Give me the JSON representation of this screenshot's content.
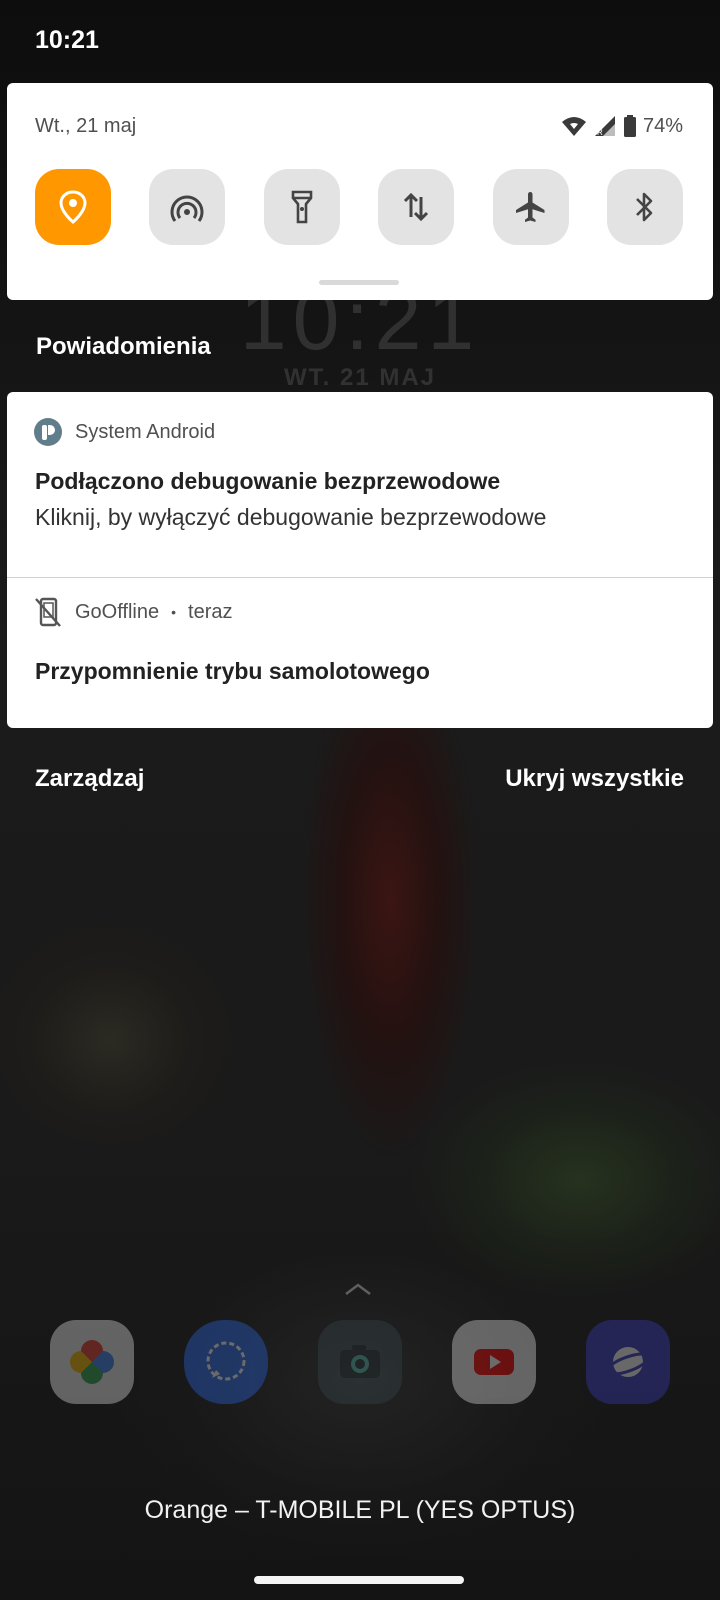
{
  "status_bar": {
    "time": "10:21"
  },
  "quick_settings": {
    "date": "Wt., 21 maj",
    "battery": "74%",
    "tiles": [
      {
        "name": "location",
        "icon": "location-pin-icon",
        "active": true
      },
      {
        "name": "hotspot",
        "icon": "hotspot-icon",
        "active": false
      },
      {
        "name": "flashlight",
        "icon": "flashlight-icon",
        "active": false
      },
      {
        "name": "mobile-data",
        "icon": "data-arrows-icon",
        "active": false
      },
      {
        "name": "airplane-mode",
        "icon": "airplane-icon",
        "active": false
      },
      {
        "name": "bluetooth",
        "icon": "bluetooth-icon",
        "active": false
      }
    ],
    "active_color": "#ff9800",
    "inactive_color": "#e3e3e3"
  },
  "lockscreen": {
    "clock": "10:21",
    "date": "WT. 21 MAJ"
  },
  "notifications": {
    "section_title": "Powiadomienia",
    "items": [
      {
        "app": "System Android",
        "icon": "android-system-icon",
        "title": "Podłączono debugowanie bezprzewodowe",
        "text": "Kliknij, by wyłączyć debugowanie bezprzewodowe"
      },
      {
        "app": "GoOffline",
        "time": "teraz",
        "icon": "phone-offline-icon",
        "title": "Przypomnienie trybu samolotowego"
      }
    ],
    "manage_label": "Zarządzaj",
    "dismiss_all_label": "Ukryj wszystkie"
  },
  "dock": {
    "apps": [
      "google-photos-icon",
      "signal-icon",
      "camera-icon",
      "youtube-icon",
      "samsung-internet-icon"
    ]
  },
  "carrier": "Orange – T-MOBILE PL (YES OPTUS)"
}
